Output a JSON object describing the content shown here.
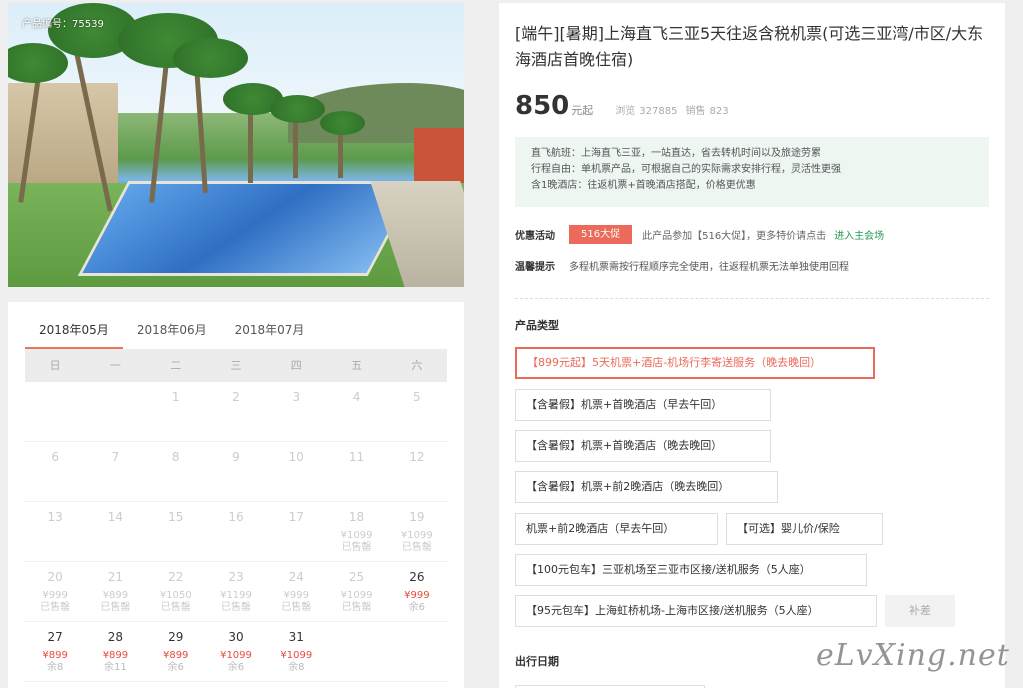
{
  "photo": {
    "id_label": "产品编号：75539"
  },
  "calendar": {
    "tabs": [
      "2018年05月",
      "2018年06月",
      "2018年07月"
    ],
    "weekdays": [
      "日",
      "一",
      "二",
      "三",
      "四",
      "五",
      "六"
    ],
    "rows": [
      [
        {
          "d": ""
        },
        {
          "d": ""
        },
        {
          "d": "1"
        },
        {
          "d": "2"
        },
        {
          "d": "3"
        },
        {
          "d": "4"
        },
        {
          "d": "5"
        }
      ],
      [
        {
          "d": "6"
        },
        {
          "d": "7"
        },
        {
          "d": "8"
        },
        {
          "d": "9"
        },
        {
          "d": "10"
        },
        {
          "d": "11"
        },
        {
          "d": "12"
        }
      ],
      [
        {
          "d": "13"
        },
        {
          "d": "14"
        },
        {
          "d": "15"
        },
        {
          "d": "16"
        },
        {
          "d": "17"
        },
        {
          "d": "18",
          "p": "¥1099",
          "s": "已售罄"
        },
        {
          "d": "19",
          "p": "¥1099",
          "s": "已售罄"
        }
      ],
      [
        {
          "d": "20",
          "p": "¥999",
          "s": "已售罄"
        },
        {
          "d": "21",
          "p": "¥899",
          "s": "已售罄"
        },
        {
          "d": "22",
          "p": "¥1050",
          "s": "已售罄"
        },
        {
          "d": "23",
          "p": "¥1199",
          "s": "已售罄"
        },
        {
          "d": "24",
          "p": "¥999",
          "s": "已售罄"
        },
        {
          "d": "25",
          "p": "¥1099",
          "s": "已售罄"
        },
        {
          "d": "26",
          "p": "¥999",
          "s": "余6",
          "avail": true
        }
      ],
      [
        {
          "d": "27",
          "p": "¥899",
          "s": "余8",
          "avail": true
        },
        {
          "d": "28",
          "p": "¥899",
          "s": "余11",
          "avail": true
        },
        {
          "d": "29",
          "p": "¥899",
          "s": "余6",
          "avail": true
        },
        {
          "d": "30",
          "p": "¥1099",
          "s": "余6",
          "avail": true
        },
        {
          "d": "31",
          "p": "¥1099",
          "s": "余8",
          "avail": true
        },
        {
          "d": ""
        },
        {
          "d": ""
        }
      ]
    ]
  },
  "product": {
    "title": "[端午][暑期]上海直飞三亚5天往返含税机票(可选三亚湾/市区/大东海酒店首晚住宿)",
    "price": "850",
    "price_unit": "元起",
    "views_label": "浏览",
    "views": "327885",
    "sales_label": "销售",
    "sales": "823",
    "features": [
      "直飞航班：上海直飞三亚，一站直达，省去转机时间以及旅途劳累",
      "行程自由：单机票产品，可根据自己的实际需求安排行程，灵活性更强",
      "含1晚酒店：往返机票+首晚酒店搭配，价格更优惠"
    ],
    "promo_label": "优惠活动",
    "promo_badge": "516大促",
    "promo_text": "此产品参加【516大促】，更多特价请点击",
    "promo_link": "进入主会场",
    "tip_label": "温馨提示",
    "tip_text": "多程机票需按行程顺序完全使用，往返程机票无法单独使用回程",
    "type_title": "产品类型",
    "options": [
      "【899元起】5天机票+酒店-机场行李寄送服务（晚去晚回）",
      "【含暑假】机票+首晚酒店（早去午回）",
      "【含暑假】机票+首晚酒店（晚去晚回）",
      "【含暑假】机票+前2晚酒店（晚去晚回）",
      "机票+前2晚酒店（早去午回）",
      "【可选】婴儿价/保险",
      "【100元包车】三亚机场至三亚市区接/送机服务（5人座）",
      "【95元包车】上海虹桥机场-上海市区接/送机服务（5人座）",
      "补差"
    ],
    "date_title": "出行日期"
  },
  "watermark": "eLvXing.net",
  "colors": {
    "accent": "#ec6a59",
    "link": "#2a9a55",
    "feature_bg": "#eef6f2"
  }
}
